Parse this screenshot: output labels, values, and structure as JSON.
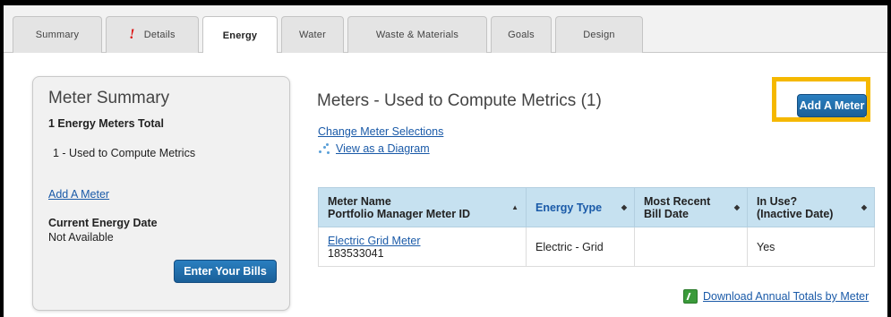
{
  "tabs": [
    {
      "label": "Summary"
    },
    {
      "label": "Details",
      "alert": "!"
    },
    {
      "label": "Energy"
    },
    {
      "label": "Water"
    },
    {
      "label": "Waste & Materials"
    },
    {
      "label": "Goals"
    },
    {
      "label": "Design"
    }
  ],
  "active_tab": "Energy",
  "summary": {
    "title": "Meter Summary",
    "total": "1 Energy Meters Total",
    "used": "1 - Used to Compute Metrics",
    "add_link": "Add A Meter",
    "date_label": "Current Energy Date",
    "date_value": "Not Available",
    "enter_bills": "Enter Your Bills"
  },
  "main": {
    "title": "Meters - Used to Compute Metrics (1)",
    "change_link": "Change Meter Selections",
    "diagram_link": "View as a Diagram",
    "add_meter_button": "Add A Meter",
    "download_link": "Download Annual Totals by Meter"
  },
  "table": {
    "headers": {
      "col1_line1": "Meter Name",
      "col1_line2": "Portfolio Manager Meter ID",
      "col2": "Energy Type",
      "col3_line1": "Most Recent",
      "col3_line2": "Bill Date",
      "col4_line1": "In Use?",
      "col4_line2": "(Inactive Date)"
    },
    "rows": [
      {
        "meter_name": "Electric Grid Meter",
        "meter_id": "183533041",
        "energy_type": "Electric - Grid",
        "bill_date": "",
        "in_use": "Yes"
      }
    ]
  },
  "colors": {
    "accent_blue": "#1a5f98",
    "highlight": "#f5b800",
    "table_header": "#c6e1f0"
  }
}
